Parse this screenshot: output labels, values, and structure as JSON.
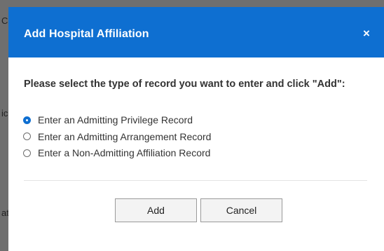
{
  "background": {
    "fragments": [
      "C",
      "ic",
      "at"
    ]
  },
  "dialog": {
    "title": "Add Hospital Affiliation",
    "close_label": "×",
    "prompt": "Please select the type of record you want to enter and click \"Add\":",
    "options": [
      {
        "label": "Enter an Admitting Privilege Record",
        "checked": true
      },
      {
        "label": "Enter an Admitting Arrangement Record",
        "checked": false
      },
      {
        "label": "Enter a Non-Admitting Affiliation Record",
        "checked": false
      }
    ],
    "buttons": {
      "add_label": "Add",
      "cancel_label": "Cancel"
    }
  },
  "colors": {
    "header": "#0e6fd1",
    "overlay": "#7a7a7a"
  }
}
